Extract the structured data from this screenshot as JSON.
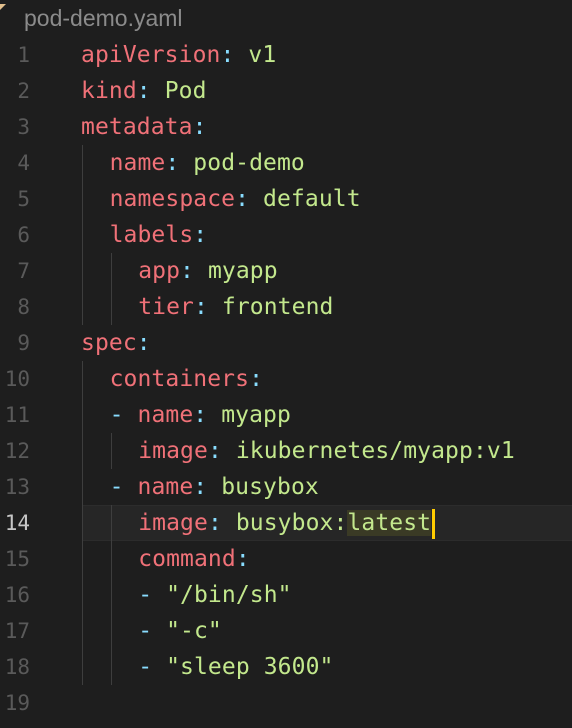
{
  "tab": {
    "filename": "pod-demo.yaml"
  },
  "lines": [
    {
      "n": "1",
      "indent": 0,
      "dash": "",
      "key": "apiVersion",
      "sep": ":",
      "value": "v1"
    },
    {
      "n": "2",
      "indent": 0,
      "dash": "",
      "key": "kind",
      "sep": ":",
      "value": "Pod"
    },
    {
      "n": "3",
      "indent": 0,
      "dash": "",
      "key": "metadata",
      "sep": ":",
      "value": ""
    },
    {
      "n": "4",
      "indent": 1,
      "dash": "",
      "key": "name",
      "sep": ":",
      "value": "pod-demo"
    },
    {
      "n": "5",
      "indent": 1,
      "dash": "",
      "key": "namespace",
      "sep": ":",
      "value": "default"
    },
    {
      "n": "6",
      "indent": 1,
      "dash": "",
      "key": "labels",
      "sep": ":",
      "value": ""
    },
    {
      "n": "7",
      "indent": 2,
      "dash": "",
      "key": "app",
      "sep": ":",
      "value": "myapp"
    },
    {
      "n": "8",
      "indent": 2,
      "dash": "",
      "key": "tier",
      "sep": ":",
      "value": "frontend"
    },
    {
      "n": "9",
      "indent": 0,
      "dash": "",
      "key": "spec",
      "sep": ":",
      "value": ""
    },
    {
      "n": "10",
      "indent": 1,
      "dash": "",
      "key": "containers",
      "sep": ":",
      "value": ""
    },
    {
      "n": "11",
      "indent": 1,
      "dash": "-",
      "key": "name",
      "sep": ":",
      "value": "myapp"
    },
    {
      "n": "12",
      "indent": 2,
      "dash": "",
      "key": "image",
      "sep": ":",
      "value": "ikubernetes/myapp:v1"
    },
    {
      "n": "13",
      "indent": 1,
      "dash": "-",
      "key": "name",
      "sep": ":",
      "value": "busybox"
    },
    {
      "n": "14",
      "indent": 2,
      "dash": "",
      "key": "image",
      "sep": ":",
      "value": "busybox:",
      "selected": "latest",
      "current": true
    },
    {
      "n": "15",
      "indent": 2,
      "dash": "",
      "key": "command",
      "sep": ":",
      "value": ""
    },
    {
      "n": "16",
      "indent": 2,
      "dash": "-",
      "key": "",
      "sep": "",
      "value": "\"/bin/sh\""
    },
    {
      "n": "17",
      "indent": 2,
      "dash": "-",
      "key": "",
      "sep": "",
      "value": "\"-c\""
    },
    {
      "n": "18",
      "indent": 2,
      "dash": "-",
      "key": "",
      "sep": "",
      "value": "\"sleep 3600\""
    },
    {
      "n": "19",
      "indent": 0,
      "dash": "",
      "key": "",
      "sep": "",
      "value": ""
    }
  ],
  "colors": {
    "key": "#f07178",
    "punctuation": "#89ddff",
    "value": "#c3e88d",
    "cursor": "#ffcc00",
    "background": "#1e1e1e"
  }
}
